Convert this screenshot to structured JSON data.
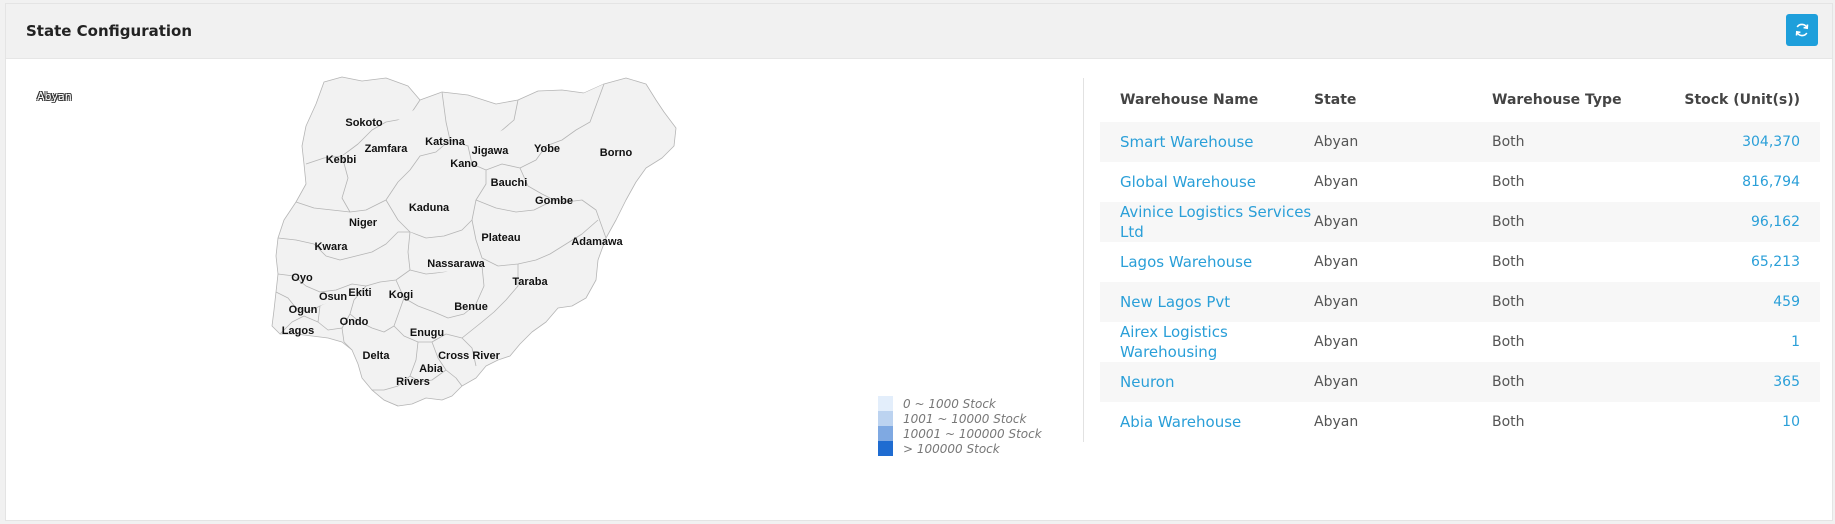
{
  "header": {
    "title": "State Configuration",
    "refresh_icon": "refresh-icon"
  },
  "map": {
    "selected_badge": "Abyan",
    "states": [
      "Sokoto",
      "Zamfara",
      "Katsina",
      "Jigawa",
      "Yobe",
      "Borno",
      "Kebbi",
      "Kano",
      "Bauchi",
      "Gombe",
      "Kaduna",
      "Niger",
      "Plateau",
      "Adamawa",
      "Kwara",
      "Nassarawa",
      "Taraba",
      "Oyo",
      "Osun",
      "Ekiti",
      "Kogi",
      "Ogun",
      "Benue",
      "Ondo",
      "Lagos",
      "Enugu",
      "Delta",
      "Cross River",
      "Abia",
      "Rivers"
    ],
    "fill_color": "#f2f2f2",
    "border_color": "#b5b5b5"
  },
  "legend": [
    {
      "label": "0 ~ 1000 Stock",
      "color": "#e3eefb"
    },
    {
      "label": "1001 ~ 10000 Stock",
      "color": "#bcd3f0"
    },
    {
      "label": "10001 ~ 100000 Stock",
      "color": "#7fa9e2"
    },
    {
      "label": "> 100000 Stock",
      "color": "#1f6cd1"
    }
  ],
  "table": {
    "headers": [
      "Warehouse Name",
      "State",
      "Warehouse Type",
      "Stock (Unit(s))"
    ],
    "rows": [
      {
        "name": "Smart Warehouse",
        "state": "Abyan",
        "type": "Both",
        "stock": "304,370"
      },
      {
        "name": "Global Warehouse",
        "state": "Abyan",
        "type": "Both",
        "stock": "816,794"
      },
      {
        "name": "Avinice Logistics Services Ltd",
        "state": "Abyan",
        "type": "Both",
        "stock": "96,162"
      },
      {
        "name": "Lagos Warehouse",
        "state": "Abyan",
        "type": "Both",
        "stock": "65,213"
      },
      {
        "name": "New Lagos Pvt",
        "state": "Abyan",
        "type": "Both",
        "stock": "459"
      },
      {
        "name": "Airex Logistics Warehousing",
        "state": "Abyan",
        "type": "Both",
        "stock": "1"
      },
      {
        "name": "Neuron",
        "state": "Abyan",
        "type": "Both",
        "stock": "365"
      },
      {
        "name": "Abia Warehouse",
        "state": "Abyan",
        "type": "Both",
        "stock": "10"
      }
    ]
  },
  "colors": {
    "accent": "#1e9fdb",
    "link": "#2a9fd8"
  }
}
